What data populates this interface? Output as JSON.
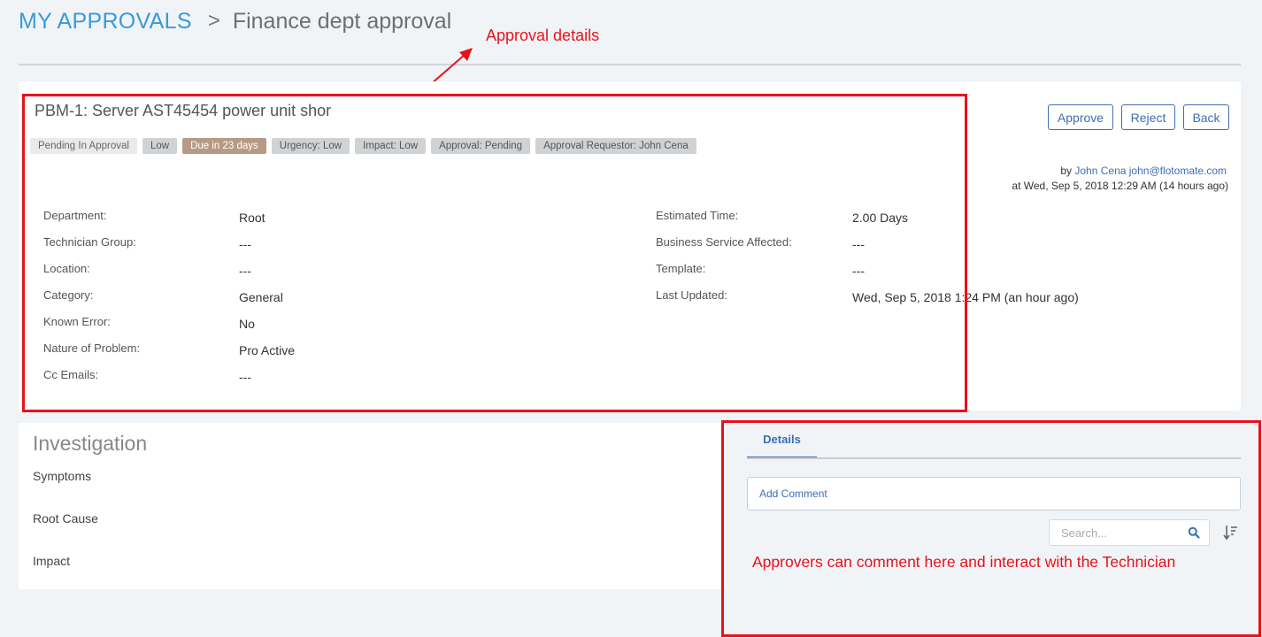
{
  "breadcrumb": {
    "root": "MY APPROVALS",
    "separator": ">",
    "current": "Finance dept approval"
  },
  "annotations": {
    "approval_details": "Approval details",
    "comment_note": "Approvers can comment here and interact with the Technician"
  },
  "ticket": {
    "title": "PBM-1: Server AST45454 power unit shor",
    "badges": [
      "Pending In Approval",
      "Low",
      "Due in 23 days",
      "Urgency: Low",
      "Impact: Low",
      "Approval: Pending",
      "Approval Requestor: John Cena"
    ]
  },
  "actions": {
    "approve": "Approve",
    "reject": "Reject",
    "back": "Back"
  },
  "meta": {
    "by_label": "by",
    "author": "John Cena",
    "email": "john@flotomate.com",
    "at_text": "at Wed, Sep 5, 2018 12:29 AM (14 hours ago)"
  },
  "left_fields": [
    {
      "label": "Department:",
      "value": "Root"
    },
    {
      "label": "Technician Group:",
      "value": "---"
    },
    {
      "label": "Location:",
      "value": "---"
    },
    {
      "label": "Category:",
      "value": "General"
    },
    {
      "label": "Known Error:",
      "value": "No"
    },
    {
      "label": "Nature of Problem:",
      "value": "Pro Active"
    },
    {
      "label": "Cc Emails:",
      "value": "---"
    }
  ],
  "right_fields": [
    {
      "label": "Estimated Time:",
      "value": "2.00 Days"
    },
    {
      "label": "Business Service Affected:",
      "value": "---"
    },
    {
      "label": "Template:",
      "value": "---"
    },
    {
      "label": "Last Updated:",
      "value": "Wed, Sep 5, 2018 1:24 PM (an hour ago)"
    }
  ],
  "investigation": {
    "title": "Investigation",
    "items": [
      "Symptoms",
      "Root Cause",
      "Impact"
    ]
  },
  "details_panel": {
    "tab": "Details",
    "add_comment": "Add Comment",
    "search_placeholder": "Search...",
    "search_icon": "search-icon",
    "sort_icon": "sort-icon"
  },
  "colors": {
    "accent": "#3d6db5",
    "breadcrumb": "#3a9ad9",
    "annotation": "#e8121b",
    "due_badge": "#b79a85"
  }
}
